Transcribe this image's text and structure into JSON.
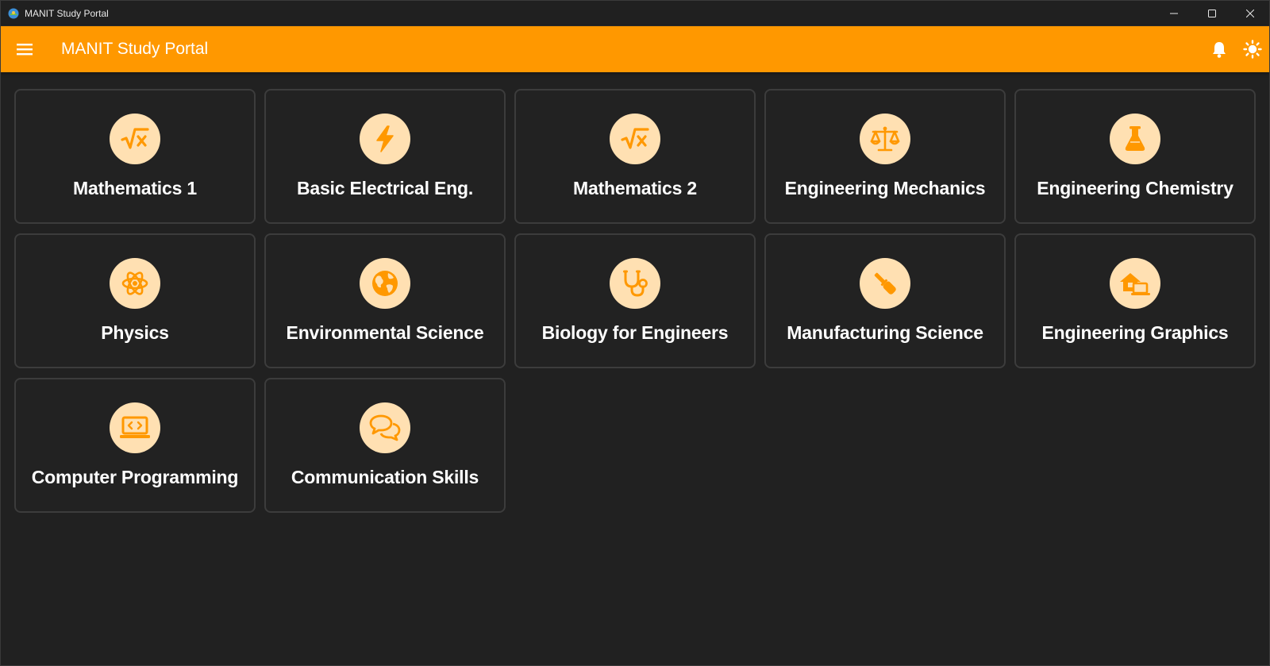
{
  "window": {
    "title": "MANIT Study Portal"
  },
  "appbar": {
    "title": "MANIT Study Portal",
    "accent": "#ff9800"
  },
  "subjects": [
    {
      "label": "Mathematics 1",
      "icon": "square-root-icon"
    },
    {
      "label": "Basic Electrical Eng.",
      "icon": "bolt-icon"
    },
    {
      "label": "Mathematics 2",
      "icon": "square-root-icon"
    },
    {
      "label": "Engineering Mechanics",
      "icon": "scale-balance-icon"
    },
    {
      "label": "Engineering Chemistry",
      "icon": "flask-icon"
    },
    {
      "label": "Physics",
      "icon": "atom-icon"
    },
    {
      "label": "Environmental Science",
      "icon": "globe-icon"
    },
    {
      "label": "Biology for Engineers",
      "icon": "stethoscope-icon"
    },
    {
      "label": "Manufacturing Science",
      "icon": "screwdriver-icon"
    },
    {
      "label": "Engineering Graphics",
      "icon": "house-laptop-icon"
    },
    {
      "label": "Computer Programming",
      "icon": "laptop-code-icon"
    },
    {
      "label": "Communication Skills",
      "icon": "chat-bubbles-icon"
    }
  ],
  "colors": {
    "card_bg": "#222222",
    "icon_circle": "#ffe0b2",
    "icon_fg": "#ff9800"
  }
}
